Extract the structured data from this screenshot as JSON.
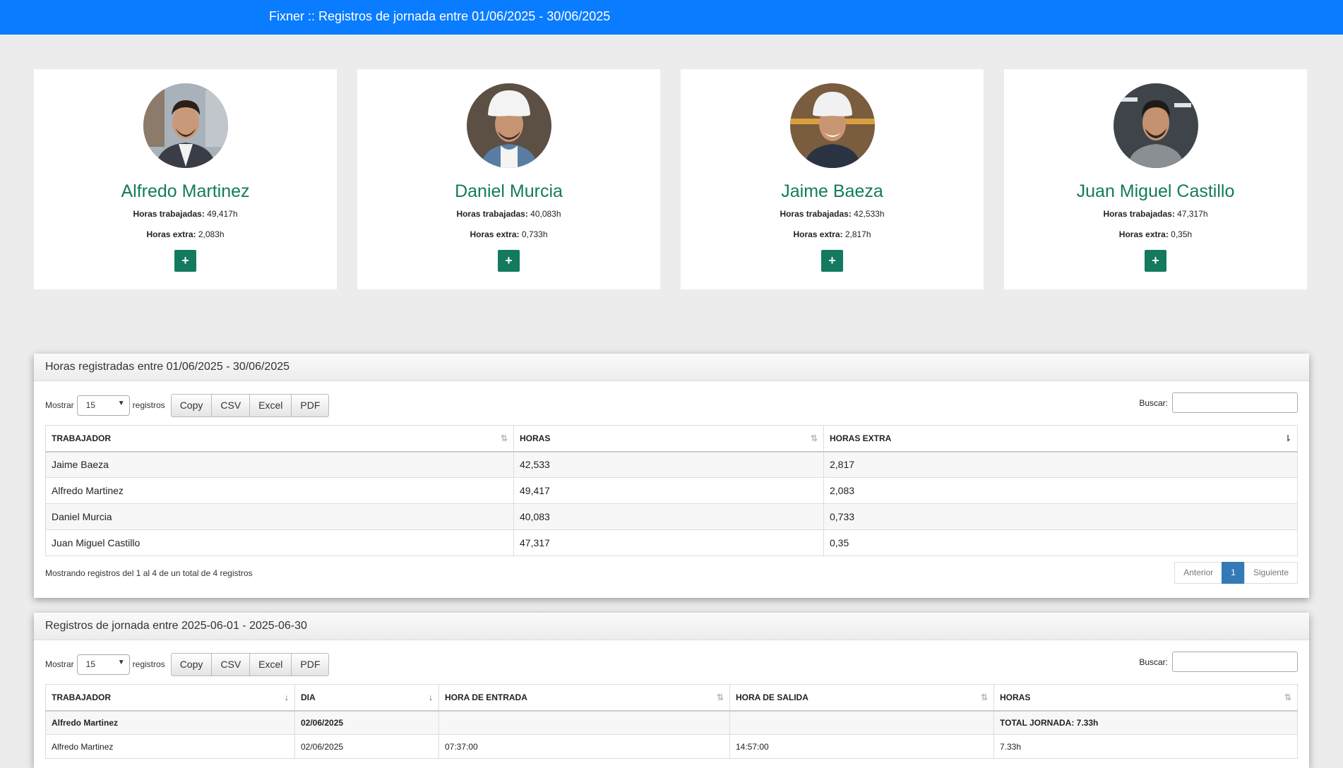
{
  "header": {
    "title": "Fixner :: Registros de jornada entre 01/06/2025 - 30/06/2025"
  },
  "cards": [
    {
      "name": "Alfredo Martinez",
      "hours_label": "Horas trabajadas:",
      "hours": "49,417h",
      "extra_label": "Horas extra:",
      "extra": "2,083h",
      "add": "+"
    },
    {
      "name": "Daniel Murcia",
      "hours_label": "Horas trabajadas:",
      "hours": "40,083h",
      "extra_label": "Horas extra:",
      "extra": "0,733h",
      "add": "+"
    },
    {
      "name": "Jaime Baeza",
      "hours_label": "Horas trabajadas:",
      "hours": "42,533h",
      "extra_label": "Horas extra:",
      "extra": "2,817h",
      "add": "+"
    },
    {
      "name": "Juan Miguel Castillo",
      "hours_label": "Horas trabajadas:",
      "hours": "47,317h",
      "extra_label": "Horas extra:",
      "extra": "0,35h",
      "add": "+"
    }
  ],
  "panel1": {
    "title": "Horas registradas entre 01/06/2025 - 30/06/2025",
    "show_label": "Mostrar",
    "show_value": "15",
    "records_label": "registros",
    "buttons": [
      "Copy",
      "CSV",
      "Excel",
      "PDF"
    ],
    "search_label": "Buscar:",
    "columns": [
      "TRABAJADOR",
      "HORAS",
      "HORAS EXTRA"
    ],
    "rows": [
      [
        "Jaime Baeza",
        "42,533",
        "2,817"
      ],
      [
        "Alfredo Martinez",
        "49,417",
        "2,083"
      ],
      [
        "Daniel Murcia",
        "40,083",
        "0,733"
      ],
      [
        "Juan Miguel Castillo",
        "47,317",
        "0,35"
      ]
    ],
    "info": "Mostrando registros del 1 al 4 de un total de 4 registros",
    "pager": {
      "prev": "Anterior",
      "page": "1",
      "next": "Siguiente"
    }
  },
  "panel2": {
    "title": "Registros de jornada entre 2025-06-01 - 2025-06-30",
    "show_label": "Mostrar",
    "show_value": "15",
    "records_label": "registros",
    "buttons": [
      "Copy",
      "CSV",
      "Excel",
      "PDF"
    ],
    "search_label": "Buscar:",
    "columns": [
      "TRABAJADOR",
      "DIA",
      "HORA DE ENTRADA",
      "HORA DE SALIDA",
      "HORAS"
    ],
    "rows": [
      [
        "Alfredo Martinez",
        "02/06/2025",
        "",
        "",
        "TOTAL JORNADA: 7.33h"
      ],
      [
        "Alfredo Martinez",
        "02/06/2025",
        "07:37:00",
        "14:57:00",
        "7.33h"
      ]
    ]
  }
}
